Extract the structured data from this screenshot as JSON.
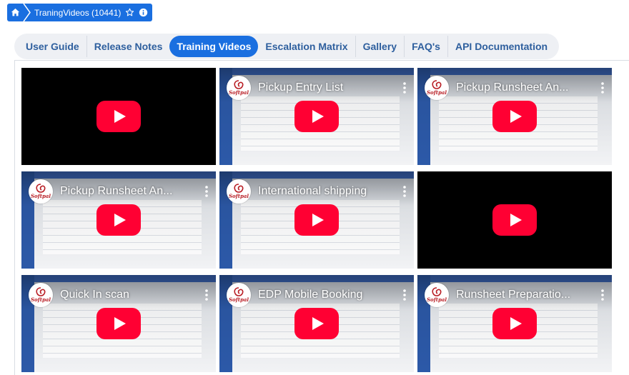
{
  "breadcrumb": {
    "current_label": "TraningVideos (10441)",
    "icons": [
      "home-icon",
      "star-outline-icon",
      "info-icon"
    ]
  },
  "tabs": [
    {
      "label": "User Guide",
      "active": false
    },
    {
      "label": "Release Notes",
      "active": false
    },
    {
      "label": "Training Videos",
      "active": true
    },
    {
      "label": "Escalation Matrix",
      "active": false
    },
    {
      "label": "Gallery",
      "active": false
    },
    {
      "label": "FAQ's",
      "active": false
    },
    {
      "label": "API Documentation",
      "active": false
    }
  ],
  "channel": {
    "logo_text": "Softpal"
  },
  "videos": [
    {
      "title": "",
      "thumbnail": false
    },
    {
      "title": "Pickup Entry List",
      "thumbnail": true
    },
    {
      "title": "Pickup Runsheet An...",
      "thumbnail": true
    },
    {
      "title": "Pickup Runsheet An...",
      "thumbnail": true
    },
    {
      "title": "International shipping",
      "thumbnail": true
    },
    {
      "title": "",
      "thumbnail": false
    },
    {
      "title": "Quick In scan",
      "thumbnail": true
    },
    {
      "title": "EDP Mobile Booking",
      "thumbnail": true
    },
    {
      "title": "Runsheet Preparatio...",
      "thumbnail": true
    }
  ],
  "colors": {
    "primary": "#1a6fe0",
    "tab_text": "#2e5f9e",
    "tab_bar_bg": "#eef0f4",
    "play_red": "#ff0033"
  }
}
